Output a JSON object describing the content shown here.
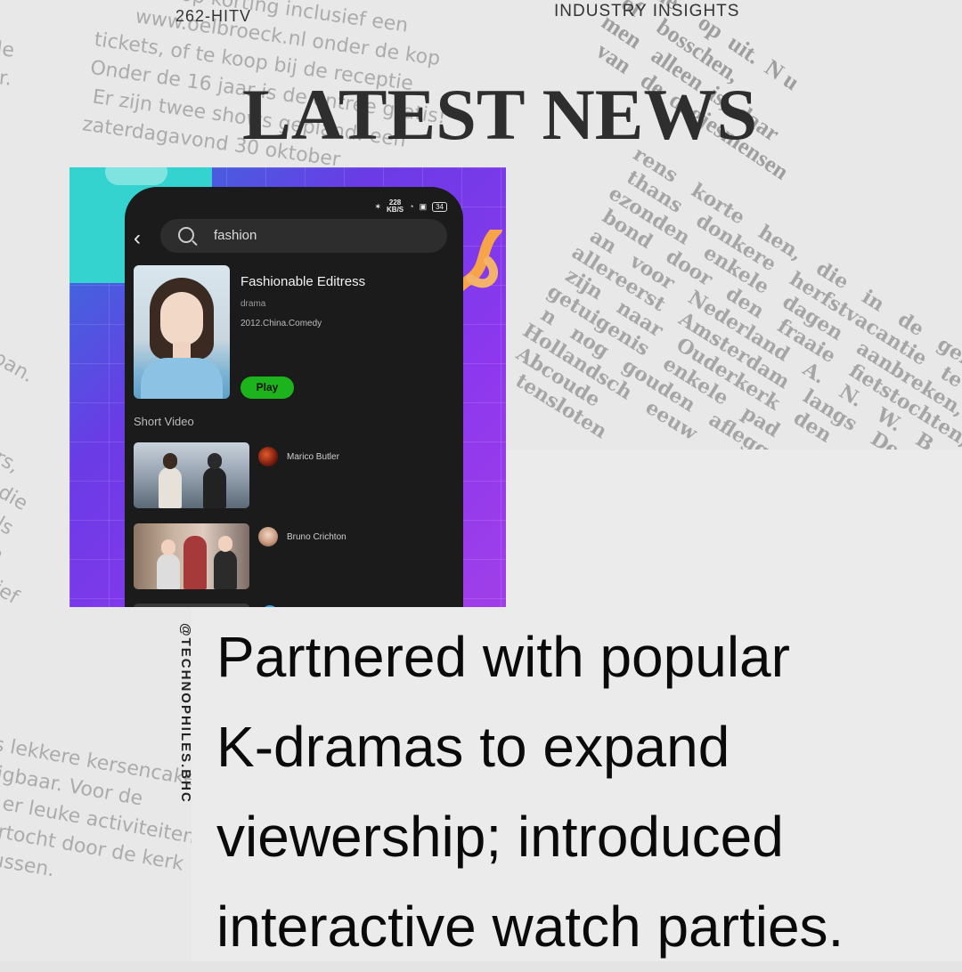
{
  "header": {
    "brand": "262-HITV",
    "category": "INDUSTRY INSIGHTS",
    "headline": "LATEST NEWS"
  },
  "handle": "@TECHNOPHILES.BHC",
  "body_lines": [
    "Partnered with popular",
    "K-dramas to expand",
    "viewership; introduced",
    "interactive watch parties."
  ],
  "app_screenshot": {
    "status": {
      "speed": "228",
      "speed_unit": "KB/S",
      "battery": "34"
    },
    "search": {
      "query": "fashion"
    },
    "result": {
      "title": "Fashionable Editress",
      "genre": "drama",
      "meta": "2012.China.Comedy",
      "play_label": "Play"
    },
    "section_label": "Short Video",
    "videos": [
      {
        "author": "Marico Butler"
      },
      {
        "author": "Bruno Crichton"
      }
    ]
  },
  "colors": {
    "background": "#e8e8e8",
    "panel": "#ebebeb",
    "headline": "#2e2e2e",
    "play_green": "#1db31d",
    "screenshot_purple": "#8d38ee",
    "screenshot_teal": "#35d3cf"
  },
  "icons": [
    "back-arrow-icon",
    "search-icon",
    "wifi-icon",
    "battery-icon",
    "ribbon-decoration"
  ]
}
